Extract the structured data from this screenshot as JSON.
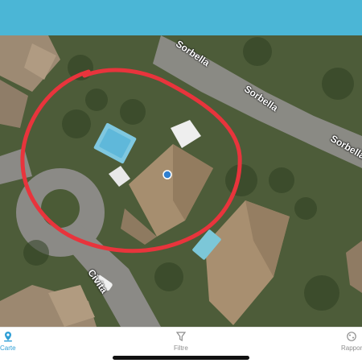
{
  "colors": {
    "header": "#4bb6d6",
    "active_tab": "#2f9fd6",
    "inactive_tab": "#8e8e8e",
    "selection_circle": "#e8343c",
    "location_dot": "#2f7fd0"
  },
  "map": {
    "streets": [
      "Sorbella",
      "Sorbella",
      "Civita"
    ]
  },
  "tabs": [
    {
      "label": "Carte",
      "icon": "map-pin-icon",
      "active": true
    },
    {
      "label": "Filtre",
      "icon": "filter-icon",
      "active": false
    },
    {
      "label": "Rappor",
      "icon": "report-icon",
      "active": false
    }
  ]
}
